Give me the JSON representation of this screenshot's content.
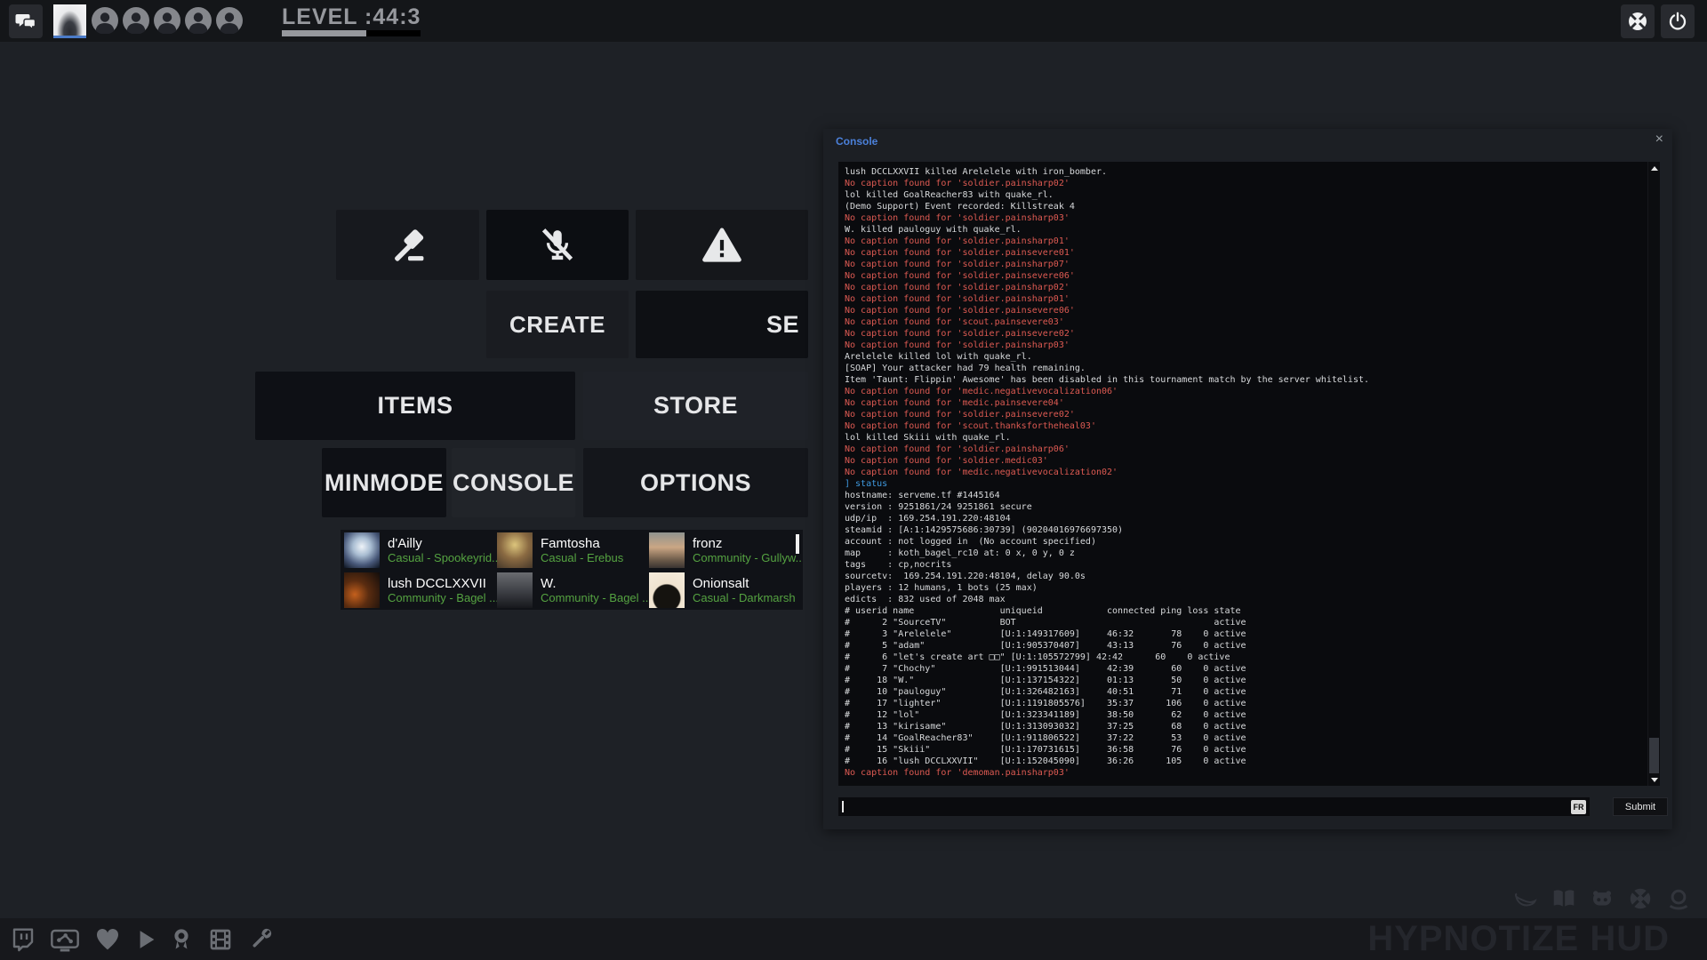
{
  "top_bar": {
    "level_label": "LEVEL :44:3",
    "xp_progress_pct": 61,
    "party_slots": 5
  },
  "menu": {
    "create": "CREATE",
    "servers": "SE",
    "items": "ITEMS",
    "store": "STORE",
    "minmode": "MINMODE",
    "console": "CONSOLE",
    "options": "OPTIONS"
  },
  "friends": [
    {
      "name": "d'Ailly",
      "status": "Casual - Spookeyrid...",
      "avatar": "radial-gradient(circle at 50% 40%, #eef3f8 0%, #a9bdd2 32%, #49597a 66%, #0d1420 100%)"
    },
    {
      "name": "Famtosha",
      "status": "Casual - Erebus",
      "avatar": "radial-gradient(circle at 50% 35%, #dcc57c 0%, #8a6a42 48%, #46382a 100%)"
    },
    {
      "name": "fronz",
      "status": "Community - Gullyw...",
      "avatar": "linear-gradient(180deg, #90938f 0%, #caa684 42%, #6b5a49 78%, #3a3431 100%)"
    },
    {
      "name": "lush DCCLXXVII",
      "status": "Community - Bagel ...",
      "avatar": "radial-gradient(circle at 30% 62%, #c4601d 0%, #5a2c10 42%, #120d0b 100%)"
    },
    {
      "name": "W.",
      "status": "Community - Bagel ...",
      "avatar": "linear-gradient(180deg, #6a6c70 0%, #3c3e44 55%, #17181c 100%)"
    },
    {
      "name": "Onionsalt",
      "status": "Casual - Darkmarsh",
      "avatar": "radial-gradient(circle at 50% 72%, #15130f 0%, #15130f 42%, #efe3cf 46%, #f5ecdc 100%)"
    }
  ],
  "console": {
    "title": "Console",
    "close_glyph": "×",
    "lang_badge": "FR",
    "submit_label": "Submit",
    "input_value": "",
    "lines": [
      {
        "c": "w",
        "t": "lush DCCLXXVII killed Arelelele with iron_bomber."
      },
      {
        "c": "r",
        "t": "No caption found for 'soldier.painsharp02'"
      },
      {
        "c": "w",
        "t": "lol killed GoalReacher83 with quake_rl."
      },
      {
        "c": "w",
        "t": "(Demo Support) Event recorded: Killstreak 4"
      },
      {
        "c": "r",
        "t": "No caption found for 'soldier.painsharp03'"
      },
      {
        "c": "w",
        "t": "W. killed pauloguy with quake_rl."
      },
      {
        "c": "r",
        "t": "No caption found for 'soldier.painsharp01'"
      },
      {
        "c": "r",
        "t": "No caption found for 'soldier.painsevere01'"
      },
      {
        "c": "r",
        "t": "No caption found for 'soldier.painsharp07'"
      },
      {
        "c": "r",
        "t": "No caption found for 'soldier.painsevere06'"
      },
      {
        "c": "r",
        "t": "No caption found for 'soldier.painsharp02'"
      },
      {
        "c": "r",
        "t": "No caption found for 'soldier.painsharp01'"
      },
      {
        "c": "r",
        "t": "No caption found for 'soldier.painsevere06'"
      },
      {
        "c": "r",
        "t": "No caption found for 'scout.painsevere03'"
      },
      {
        "c": "r",
        "t": "No caption found for 'soldier.painsevere02'"
      },
      {
        "c": "r",
        "t": "No caption found for 'soldier.painsharp03'"
      },
      {
        "c": "w",
        "t": "Arelelele killed lol with quake_rl."
      },
      {
        "c": "w",
        "t": "[SOAP] Your attacker had 79 health remaining."
      },
      {
        "c": "w",
        "t": "Item 'Taunt: Flippin' Awesome' has been disabled in this tournament match by the server whitelist."
      },
      {
        "c": "r",
        "t": "No caption found for 'medic.negativevocalization06'"
      },
      {
        "c": "r",
        "t": "No caption found for 'medic.painsevere04'"
      },
      {
        "c": "r",
        "t": "No caption found for 'soldier.painsevere02'"
      },
      {
        "c": "r",
        "t": "No caption found for 'scout.thanksfortheheal03'"
      },
      {
        "c": "w",
        "t": "lol killed Skiii with quake_rl."
      },
      {
        "c": "r",
        "t": "No caption found for 'soldier.painsharp06'"
      },
      {
        "c": "r",
        "t": "No caption found for 'soldier.medic03'"
      },
      {
        "c": "r",
        "t": "No caption found for 'medic.negativevocalization02'"
      },
      {
        "c": "b",
        "t": "] status"
      },
      {
        "c": "w",
        "t": "hostname: serveme.tf #1445164"
      },
      {
        "c": "w",
        "t": "version : 9251861/24 9251861 secure"
      },
      {
        "c": "w",
        "t": "udp/ip  : 169.254.191.220:48104"
      },
      {
        "c": "w",
        "t": "steamid : [A:1:1429575686:30739] (90204016976697350)"
      },
      {
        "c": "w",
        "t": "account : not logged in  (No account specified)"
      },
      {
        "c": "w",
        "t": "map     : koth_bagel_rc10 at: 0 x, 0 y, 0 z"
      },
      {
        "c": "w",
        "t": "tags    : cp,nocrits"
      },
      {
        "c": "w",
        "t": "sourcetv:  169.254.191.220:48104, delay 90.0s"
      },
      {
        "c": "w",
        "t": "players : 12 humans, 1 bots (25 max)"
      },
      {
        "c": "w",
        "t": "edicts  : 832 used of 2048 max"
      },
      {
        "c": "w",
        "t": "# userid name                uniqueid            connected ping loss state"
      },
      {
        "c": "w",
        "t": "#      2 \"SourceTV\"          BOT                                     active"
      },
      {
        "c": "w",
        "t": "#      3 \"Arelelele\"         [U:1:149317609]     46:32       78    0 active"
      },
      {
        "c": "w",
        "t": "#      5 \"adam\"              [U:1:905370407]     43:13       76    0 active"
      },
      {
        "c": "w",
        "t": "#      6 \"let's create art □□\" [U:1:105572799] 42:42      60    0 active"
      },
      {
        "c": "w",
        "t": "#      7 \"Chochy\"            [U:1:991513044]     42:39       60    0 active"
      },
      {
        "c": "w",
        "t": "#     18 \"W.\"                [U:1:137154322]     01:13       50    0 active"
      },
      {
        "c": "w",
        "t": "#     10 \"pauloguy\"          [U:1:326482163]     40:51       71    0 active"
      },
      {
        "c": "w",
        "t": "#     17 \"lighter\"           [U:1:1191805576]    35:37      106    0 active"
      },
      {
        "c": "w",
        "t": "#     12 \"lol\"               [U:1:323341189]     38:50       62    0 active"
      },
      {
        "c": "w",
        "t": "#     13 \"kirisame\"          [U:1:313093032]     37:25       68    0 active"
      },
      {
        "c": "w",
        "t": "#     14 \"GoalReacher83\"     [U:1:911806522]     37:22       53    0 active"
      },
      {
        "c": "w",
        "t": "#     15 \"Skiii\"             [U:1:170731615]     36:58       76    0 active"
      },
      {
        "c": "w",
        "t": "#     16 \"lush DCCLXXVII\"    [U:1:152045090]     36:26      105    0 active"
      },
      {
        "c": "r",
        "t": "No caption found for 'demoman.painsharp03'"
      }
    ]
  },
  "footer": {
    "brand": "HYPNOTIZE HUD"
  },
  "icons": {
    "top": [
      "chat-icon",
      "tf2-logo-icon",
      "power-icon"
    ],
    "menu": [
      "gavel-icon",
      "mic-muted-icon",
      "warning-icon"
    ],
    "links_right": [
      "pepper-icon",
      "book-icon",
      "github-icon",
      "tf2-logo-icon",
      "huds-tf-icon"
    ],
    "social_left": [
      "twitch-icon",
      "stream-icon",
      "heart-icon",
      "play-icon",
      "award-icon",
      "film-icon",
      "wrench-icon"
    ]
  },
  "colors": {
    "accent_blue": "#4b80da",
    "console_error_red": "#dd5a52",
    "console_command_blue": "#3f9ae0",
    "friend_status_green": "#55a341",
    "xp_bar_gray": "#96989d"
  }
}
